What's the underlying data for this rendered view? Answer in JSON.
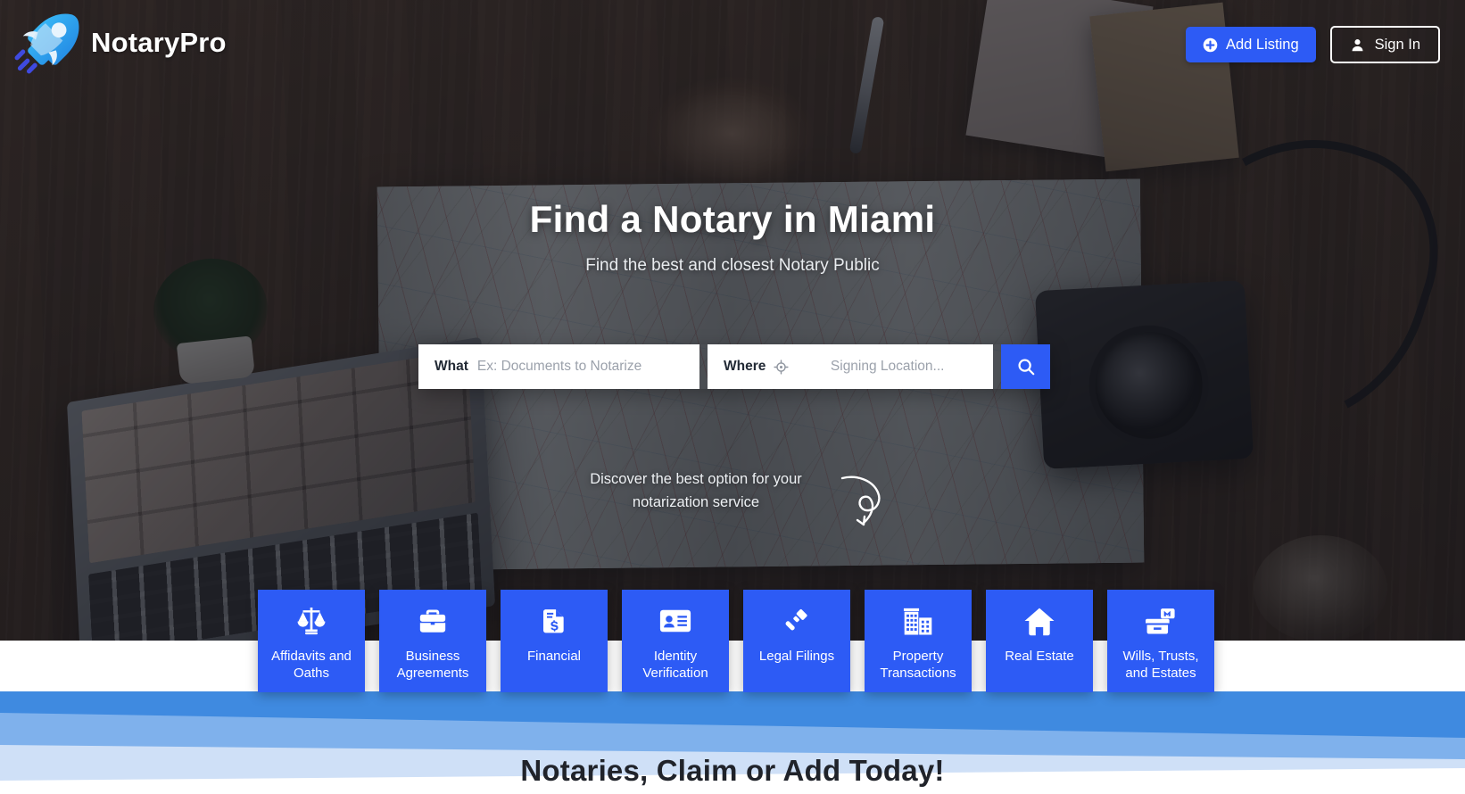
{
  "brand": {
    "name": "NotaryPro",
    "logo_icon": "rocket-icon",
    "accent_color": "#2d5bf5"
  },
  "topbar": {
    "add_listing_label": "Add Listing",
    "add_listing_icon": "plus-circle-icon",
    "sign_in_label": "Sign In",
    "sign_in_icon": "user-icon"
  },
  "hero": {
    "title": "Find a Notary in Miami",
    "subtitle": "Find the best and closest Notary Public",
    "discover_text": "Discover the best option for your notarization service",
    "discover_arrow_icon": "curved-arrow-icon"
  },
  "search": {
    "what_label": "What",
    "what_placeholder": "Ex: Documents to Notarize",
    "what_value": "",
    "where_label": "Where",
    "where_placeholder": "Signing Location...",
    "where_value": "",
    "locate_icon": "crosshair-locate-icon",
    "search_icon": "search-icon"
  },
  "categories": [
    {
      "label": "Affidavits and Oaths",
      "icon": "scales-balance-icon"
    },
    {
      "label": "Business Agreements",
      "icon": "briefcase-icon"
    },
    {
      "label": "Financial",
      "icon": "document-dollar-icon"
    },
    {
      "label": "Identity Verification",
      "icon": "id-card-icon"
    },
    {
      "label": "Legal Filings",
      "icon": "gavel-icon"
    },
    {
      "label": "Property Transactions",
      "icon": "building-icon"
    },
    {
      "label": "Real Estate",
      "icon": "home-icon"
    },
    {
      "label": "Wills, Trusts, and Estates",
      "icon": "archive-box-icon"
    }
  ],
  "ribbon": {
    "color_dark": "#3f8ae0",
    "color_mid": "#7fb1ec",
    "color_light": "#cfe0f7"
  },
  "bottom": {
    "headline": "Notaries, Claim or Add Today!"
  }
}
